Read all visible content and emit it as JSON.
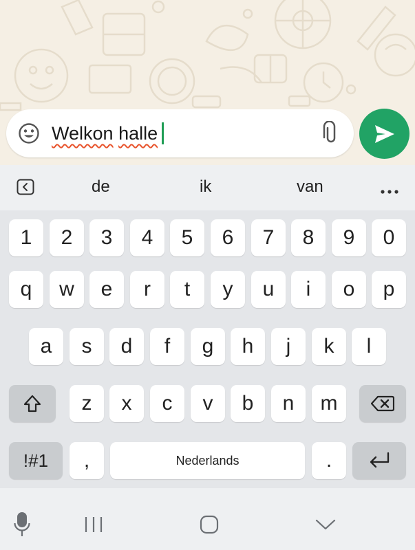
{
  "composer": {
    "message_word1": "Welkon",
    "message_space": " ",
    "message_word2": "halle",
    "emoji_icon": "smiley-face-icon",
    "attach_icon": "paperclip-icon",
    "send_icon": "send-arrow-icon"
  },
  "suggestions": {
    "items": [
      "de",
      "ik",
      "van"
    ],
    "collapse_icon": "chevron-left-box-icon",
    "more_icon": "more-dots-icon"
  },
  "keyboard": {
    "row_numbers": [
      "1",
      "2",
      "3",
      "4",
      "5",
      "6",
      "7",
      "8",
      "9",
      "0"
    ],
    "row_top": [
      "q",
      "w",
      "e",
      "r",
      "t",
      "y",
      "u",
      "i",
      "o",
      "p"
    ],
    "row_home": [
      "a",
      "s",
      "d",
      "f",
      "g",
      "h",
      "j",
      "k",
      "l"
    ],
    "row_bottom": [
      "z",
      "x",
      "c",
      "v",
      "b",
      "n",
      "m"
    ],
    "symbols_label": "!#1",
    "comma_label": ",",
    "space_label": "Nederlands",
    "period_label": ".",
    "shift_icon": "shift-arrow-icon",
    "backspace_icon": "backspace-icon",
    "enter_icon": "enter-return-icon"
  },
  "navbar": {
    "mic_icon": "microphone-icon",
    "recents_icon": "recent-apps-icon",
    "home_icon": "home-icon",
    "hide_keyboard_icon": "chevron-down-icon"
  },
  "colors": {
    "send_green": "#21a365",
    "caret_green": "#1f9d55",
    "spell_underline": "#e8542d",
    "chat_background": "#f5efe4"
  }
}
